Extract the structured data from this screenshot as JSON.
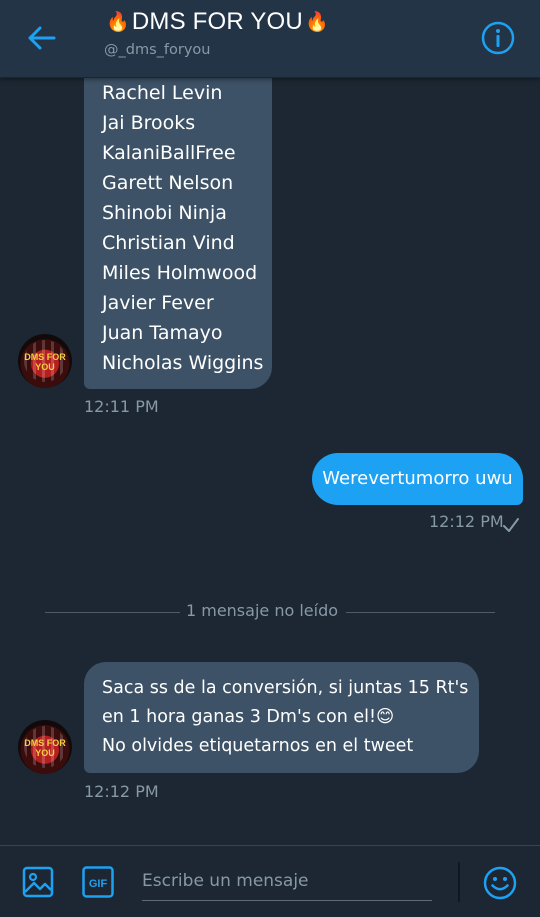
{
  "header": {
    "title": "DMS FOR YOU",
    "flame_icon": "🔥",
    "handle": "@_dms_foryou"
  },
  "messages": {
    "list_names": [
      "Rachel Levin",
      "Jai Brooks",
      "KalaniBallFree",
      "Garett Nelson",
      "Shinobi Ninja",
      "Christian Vind",
      "Miles Holmwood",
      "Javier Fever",
      "Juan Tamayo",
      "Nicholas Wiggins"
    ],
    "list_time": "12:11 PM",
    "outgoing_text": "Werevertumorro uwu",
    "outgoing_time": "12:12 PM",
    "unread_label": "1 mensaje no leído",
    "incoming": {
      "line1": "Saca ss de la conversión, si juntas 15 Rt's",
      "line2": "en 1 hora ganas 3 Dm's con el!😊",
      "line3": "No olvides etiquetarnos en el tweet"
    },
    "incoming_time": "12:12 PM"
  },
  "avatar": {
    "text": "DMS FOR YOU"
  },
  "composer": {
    "placeholder": "Escribe un mensaje",
    "gif_label": "GIF"
  },
  "colors": {
    "background": "#1c2733",
    "header": "#243447",
    "accent": "#1da1f2",
    "bubble_in": "#3d5266",
    "secondary_text": "#8899a6"
  }
}
